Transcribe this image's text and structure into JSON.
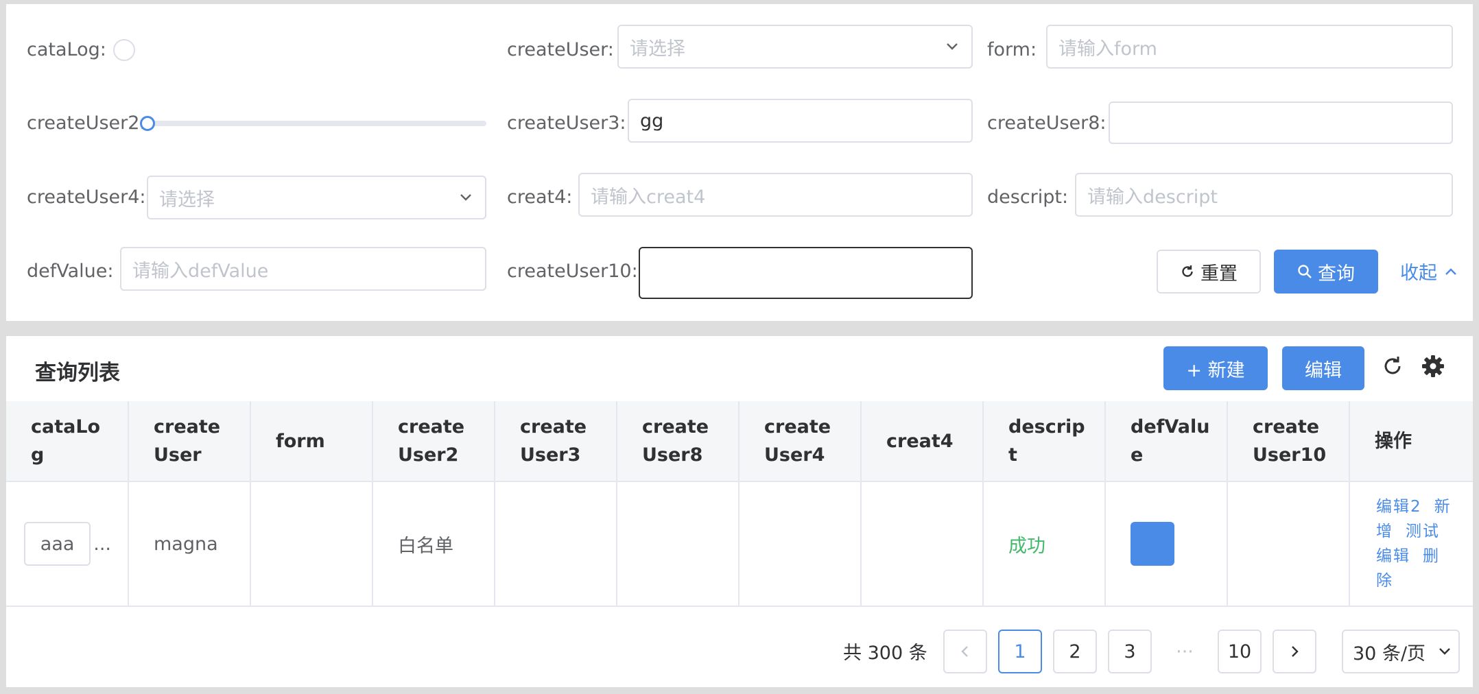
{
  "search": {
    "fields": {
      "catalog": {
        "label": "cataLog:"
      },
      "createUser": {
        "label": "createUser:",
        "placeholder": "请选择"
      },
      "form": {
        "label": "form:",
        "placeholder": "请输入form"
      },
      "createUser2": {
        "label": "createUser2:",
        "slider_value": 0
      },
      "createUser3": {
        "label": "createUser3:",
        "value": "gg"
      },
      "createUser8": {
        "label": "createUser8:"
      },
      "createUser4": {
        "label": "createUser4:",
        "placeholder": "请选择"
      },
      "creat4": {
        "label": "creat4:",
        "placeholder": "请输入creat4"
      },
      "descript": {
        "label": "descript:",
        "placeholder": "请输入descript"
      },
      "defValue": {
        "label": "defValue:",
        "placeholder": "请输入defValue"
      },
      "createUser10": {
        "label": "createUser10:"
      }
    },
    "reset_label": "重置",
    "query_label": "查询",
    "collapse_label": "收起"
  },
  "table": {
    "title": "查询列表",
    "new_label": "+ 新建",
    "edit_label": "编辑",
    "columns": [
      "cataLog",
      "createUser",
      "form",
      "createUser2",
      "createUser3",
      "createUser8",
      "createUser4",
      "creat4",
      "descript",
      "defValue",
      "createUser10",
      "操作"
    ],
    "row": {
      "cataLog": "aaa",
      "ellipsis": "...",
      "createUser": "magna",
      "createUser2": "白名单",
      "descript": "成功",
      "ops": [
        "编辑2",
        "新增",
        "测试",
        "编辑",
        "删除"
      ]
    }
  },
  "pagination": {
    "total": "共 300 条",
    "pages": [
      "1",
      "2",
      "3",
      "···",
      "10"
    ],
    "current": "1",
    "page_size": "30 条/页"
  },
  "colors": {
    "primary": "#4a8be8",
    "success": "#43b96b"
  }
}
